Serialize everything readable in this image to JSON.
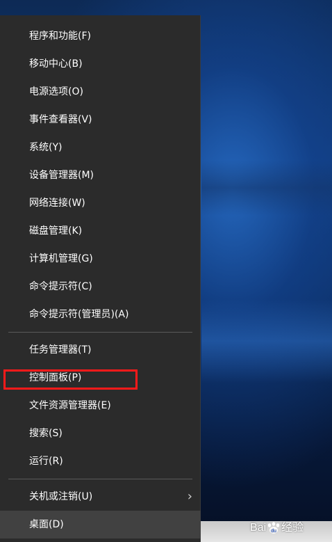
{
  "menu": {
    "items_group1": [
      {
        "label": "程序和功能(F)"
      },
      {
        "label": "移动中心(B)"
      },
      {
        "label": "电源选项(O)"
      },
      {
        "label": "事件查看器(V)"
      },
      {
        "label": "系统(Y)"
      },
      {
        "label": "设备管理器(M)"
      },
      {
        "label": "网络连接(W)"
      },
      {
        "label": "磁盘管理(K)"
      },
      {
        "label": "计算机管理(G)"
      },
      {
        "label": "命令提示符(C)"
      },
      {
        "label": "命令提示符(管理员)(A)"
      }
    ],
    "items_group2": [
      {
        "label": "任务管理器(T)"
      },
      {
        "label": "控制面板(P)"
      },
      {
        "label": "文件资源管理器(E)"
      },
      {
        "label": "搜索(S)"
      },
      {
        "label": "运行(R)"
      }
    ],
    "items_group3": [
      {
        "label": "关机或注销(U)",
        "has_submenu": true
      },
      {
        "label": "桌面(D)",
        "hovered": true
      }
    ]
  },
  "watermark": {
    "text_brand": "Bai",
    "text_suffix": "经验"
  },
  "colors": {
    "menu_bg": "#2b2b2b",
    "highlight": "#ff1a1a",
    "hover_bg": "#414141"
  }
}
